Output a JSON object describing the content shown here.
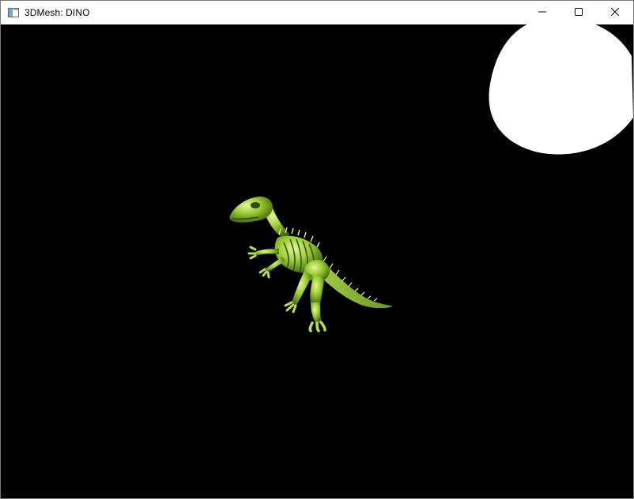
{
  "window": {
    "title": "3DMesh: DINO",
    "icon": "app-window-icon",
    "controls": {
      "minimize_icon": "minimize-icon",
      "maximize_icon": "maximize-icon",
      "close_icon": "close-icon"
    }
  },
  "scene": {
    "background_color": "#000000",
    "model_color": "#9acd32",
    "light_blob_color": "#ffffff"
  }
}
